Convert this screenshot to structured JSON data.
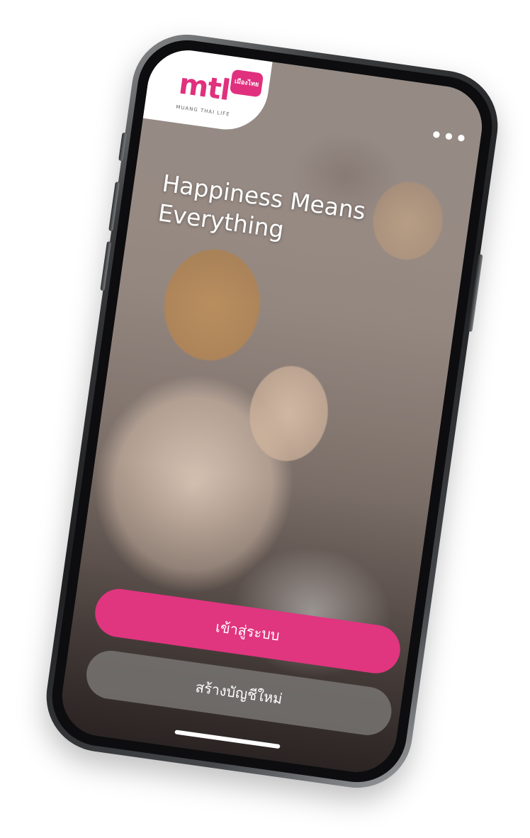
{
  "brand": {
    "logo_text": "mtl",
    "badge_text": "เมืองไทย",
    "tagline": "MUANG THAI LIFE",
    "accent_color": "#e0307e"
  },
  "header": {
    "more_icon": "more-horizontal-icon",
    "more_label": "•••"
  },
  "hero": {
    "line1": "Happiness Means",
    "line2": "Everything"
  },
  "actions": {
    "login_label": "เข้าสู่ระบบ",
    "register_label": "สร้างบัญชีใหม่"
  }
}
